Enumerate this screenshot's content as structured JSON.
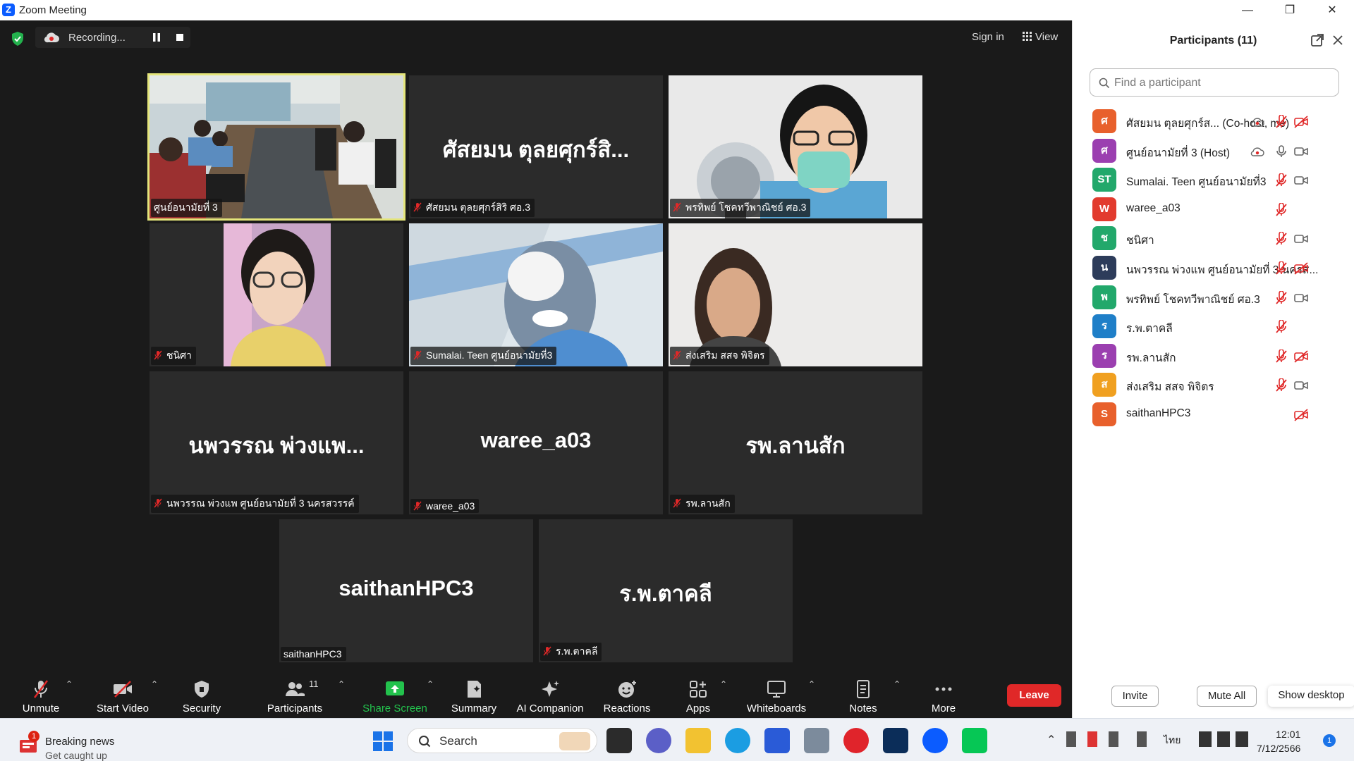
{
  "window": {
    "title": "Zoom Meeting",
    "minimize": "—",
    "restore": "❐",
    "close": "✕"
  },
  "topbar": {
    "recording": "Recording...",
    "sign_in": "Sign in",
    "view": "View"
  },
  "tiles": [
    {
      "label": "ศูนย์อนามัยที่ 3",
      "muted": false,
      "video": true,
      "active": true
    },
    {
      "big": "ศัสยมน ตุลยศุกร์สิ...",
      "label": "ศัสยมน ตุลยศุกร์สิริ ศอ.3",
      "muted": true
    },
    {
      "label": "พรทิพย์ โชคทวีพาณิชย์ ศอ.3",
      "muted": true,
      "video": true
    },
    {
      "label": "ชนิศา",
      "muted": true,
      "video": true
    },
    {
      "label": "Sumalai. Teen ศูนย์อนามัยที่3",
      "muted": true,
      "video": true
    },
    {
      "label": "ส่งเสริม สสจ พิจิตร",
      "muted": true,
      "video": true
    },
    {
      "big": "นพวรรณ พ่วงแพ...",
      "label": "นพวรรณ พ่วงแพ ศูนย์อนามัยที่ 3 นครสวรรค์",
      "muted": true
    },
    {
      "big": "waree_a03",
      "label": "waree_a03",
      "muted": true
    },
    {
      "big": "รพ.ลานสัก",
      "label": "รพ.ลานสัก",
      "muted": true
    },
    {
      "big": "saithanHPC3",
      "label": "saithanHPC3",
      "muted": false
    },
    {
      "big": "ร.พ.ตาคลี",
      "label": "ร.พ.ตาคลี",
      "muted": true
    }
  ],
  "toolbar": {
    "unmute": "Unmute",
    "start_video": "Start Video",
    "security": "Security",
    "participants": "Participants",
    "participants_count": "11",
    "share_screen": "Share Screen",
    "summary": "Summary",
    "ai_companion": "AI Companion",
    "reactions": "Reactions",
    "apps": "Apps",
    "whiteboards": "Whiteboards",
    "notes": "Notes",
    "more": "More",
    "leave": "Leave"
  },
  "panel": {
    "title": "Participants (11)",
    "search_placeholder": "Find a participant",
    "participants": [
      {
        "initial": "ศ",
        "name": "ศัสยมน ตุลยศุกร์ส... (Co-host, me)",
        "color": "#e8602c",
        "rec": true,
        "mic": "muted",
        "cam": "off"
      },
      {
        "initial": "ศ",
        "name": "ศูนย์อนามัยที่ 3 (Host)",
        "color": "#9b3fb0",
        "rec": true,
        "mic": "on",
        "cam": "on"
      },
      {
        "initial": "ST",
        "name": "Sumalai. Teen ศูนย์อนามัยที่3",
        "color": "#22a86b",
        "mic": "muted",
        "cam": "on"
      },
      {
        "initial": "W",
        "name": "waree_a03",
        "color": "#e23b2e",
        "mic": "muted"
      },
      {
        "initial": "ช",
        "name": "ชนิศา",
        "color": "#22a86b",
        "mic": "muted",
        "cam": "on"
      },
      {
        "initial": "น",
        "name": "นพวรรณ พ่วงแพ ศูนย์อนามัยที่ 3 นครส...",
        "color": "#2d3c5a",
        "mic": "muted",
        "cam": "off"
      },
      {
        "initial": "พ",
        "name": "พรทิพย์ โชคทวีพาณิชย์ ศอ.3",
        "color": "#22a86b",
        "mic": "muted",
        "cam": "on"
      },
      {
        "initial": "ร",
        "name": "ร.พ.ตาคลี",
        "color": "#1f7fc8",
        "mic": "muted"
      },
      {
        "initial": "ร",
        "name": "รพ.ลานสัก",
        "color": "#9b3fb0",
        "mic": "muted",
        "cam": "off"
      },
      {
        "initial": "ส",
        "name": "ส่งเสริม สสจ พิจิตร",
        "color": "#f0a020",
        "mic": "muted",
        "cam": "on"
      },
      {
        "initial": "S",
        "name": "saithanHPC3",
        "color": "#e8602c",
        "cam": "off"
      }
    ],
    "invite": "Invite",
    "mute_all": "Mute All",
    "show_desktop": "Show desktop"
  },
  "taskbar": {
    "news_badge": "1",
    "news_title": "Breaking news",
    "news_sub": "Get caught up",
    "search": "Search",
    "lang": "ไทย",
    "time": "12:01",
    "date": "7/12/2566",
    "notif": "1"
  }
}
